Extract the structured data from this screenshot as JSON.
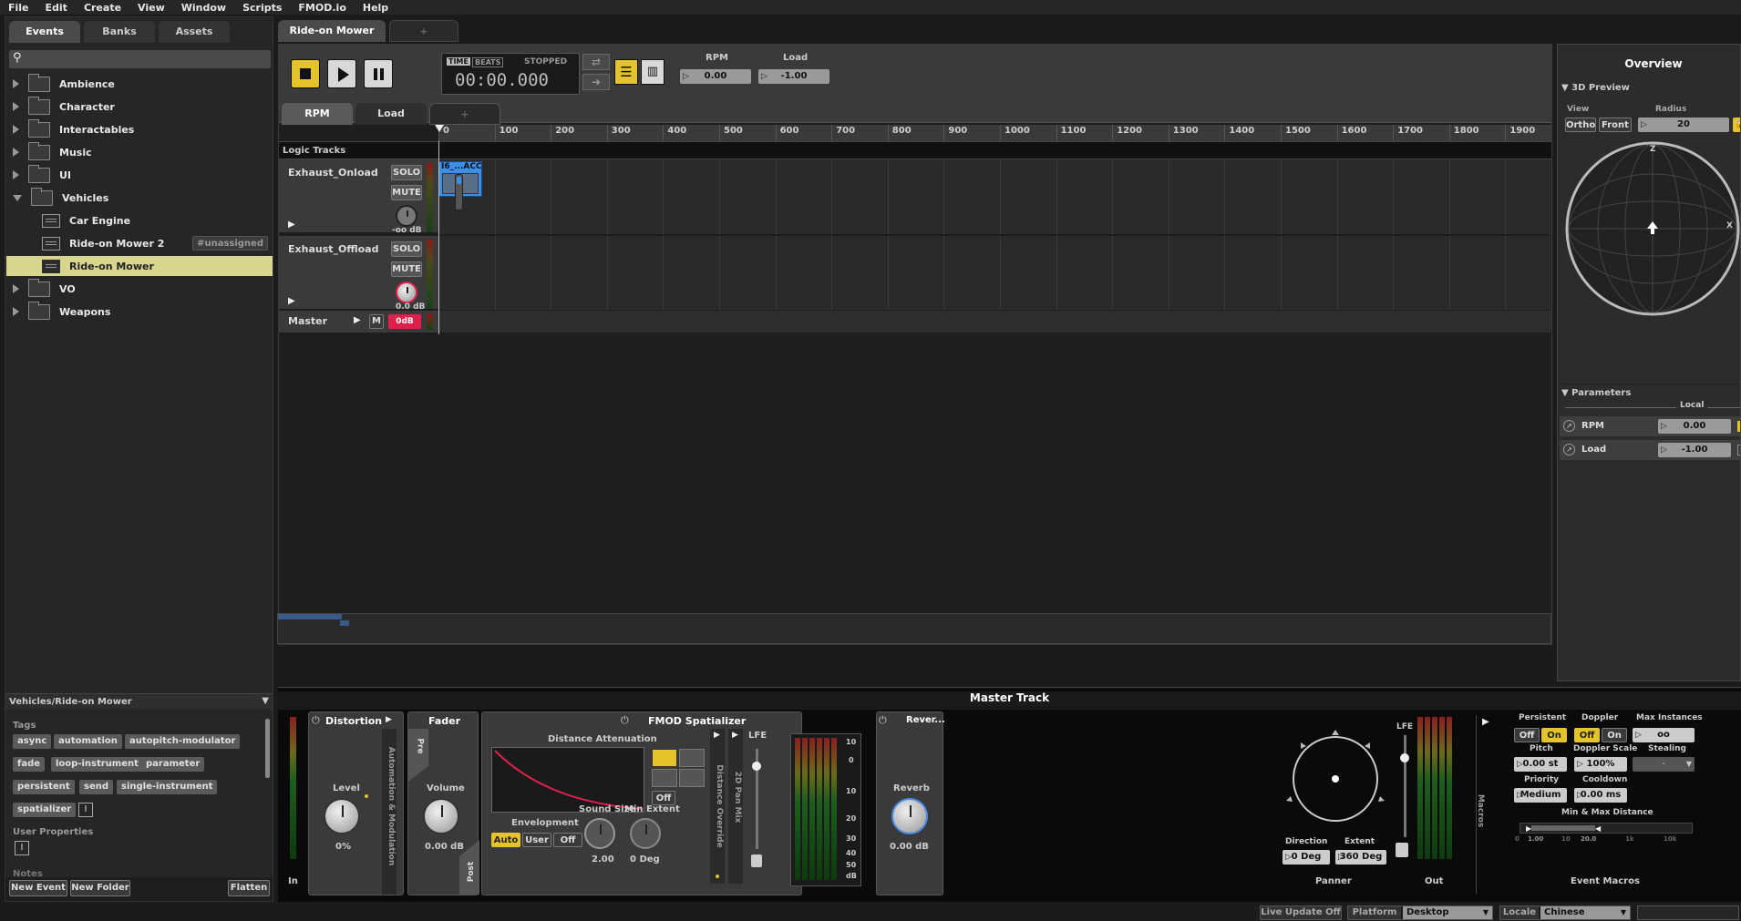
{
  "menu": [
    "File",
    "Edit",
    "Create",
    "View",
    "Window",
    "Scripts",
    "FMOD.io",
    "Help"
  ],
  "browser": {
    "tabs": [
      "Events",
      "Banks",
      "Assets"
    ],
    "search_placeholder": "",
    "items": [
      {
        "label": "Ambience",
        "type": "folder"
      },
      {
        "label": "Character",
        "type": "folder"
      },
      {
        "label": "Interactables",
        "type": "folder"
      },
      {
        "label": "Music",
        "type": "folder"
      },
      {
        "label": "UI",
        "type": "folder"
      },
      {
        "label": "Vehicles",
        "type": "folder-open"
      },
      {
        "label": "Car Engine",
        "type": "event"
      },
      {
        "label": "Ride-on Mower 2",
        "type": "event",
        "badge": "#unassigned"
      },
      {
        "label": "Ride-on Mower",
        "type": "event",
        "selected": true
      },
      {
        "label": "VO",
        "type": "folder"
      },
      {
        "label": "Weapons",
        "type": "folder"
      }
    ],
    "path": "Vehicles/Ride-on Mower",
    "tags_label": "Tags",
    "tags": [
      "async",
      "automation",
      "autopitch-modulator",
      "fade",
      "loop-instrument",
      "parameter",
      "persistent",
      "send",
      "single-instrument",
      "spatializer"
    ],
    "user_properties_label": "User Properties",
    "notes_label": "Notes",
    "new_event": "New Event",
    "new_folder": "New Folder",
    "flatten": "Flatten"
  },
  "editor": {
    "tab": "Ride-on Mower",
    "add_tab": "+",
    "transport": {
      "time_label": "TIME",
      "beats_label": "BEATS",
      "state": "STOPPED",
      "time": "00:00.000"
    },
    "params_header": [
      {
        "name": "RPM",
        "value": "0.00"
      },
      {
        "name": "Load",
        "value": "-1.00"
      }
    ],
    "param_tabs": [
      "RPM",
      "Load",
      "+"
    ],
    "logic_tracks": "Logic Tracks",
    "ruler": [
      "0",
      "100",
      "200",
      "300",
      "400",
      "500",
      "600",
      "700",
      "800",
      "900",
      "1000",
      "1100",
      "1200",
      "1300",
      "1400",
      "1500",
      "1600",
      "1700",
      "1800",
      "1900"
    ],
    "tracks": [
      {
        "name": "Exhaust_Onload",
        "solo": "SOLO",
        "mute": "MUTE",
        "vol": "-oo dB",
        "region": "I6_...ACC"
      },
      {
        "name": "Exhaust_Offload",
        "solo": "SOLO",
        "mute": "MUTE",
        "vol": "0.0 dB"
      }
    ],
    "master": {
      "name": "Master",
      "m": "M",
      "vol": "0dB"
    }
  },
  "overview": {
    "title": "Overview",
    "preview_label": "3D Preview",
    "view_label": "View",
    "radius_label": "Radius",
    "ortho": "Ortho",
    "front": "Front",
    "radius": "20",
    "axis_z": "Z",
    "axis_x": "X",
    "parameters_label": "Parameters",
    "local_label": "Local",
    "params": [
      {
        "name": "RPM",
        "value": "0.00"
      },
      {
        "name": "Load",
        "value": "-1.00"
      }
    ]
  },
  "deck": {
    "title": "Master Track",
    "in_label": "In",
    "distortion": {
      "title": "Distortion",
      "level_label": "Level",
      "level": "0%",
      "automation": "Automation & Modulation"
    },
    "fader": {
      "title": "Fader",
      "pre": "Pre",
      "post": "Post",
      "volume_label": "Volume",
      "volume": "0.00 dB"
    },
    "spatializer": {
      "title": "FMOD Spatializer",
      "atten_label": "Distance Attenuation",
      "off": "Off",
      "envelopment": "Envelopment",
      "env_opts": [
        "Auto",
        "User",
        "Off"
      ],
      "sound_size_label": "Sound Size",
      "sound_size": "2.00",
      "min_extent_label": "Min Extent",
      "min_extent": "0 Deg",
      "override": "Distance Override",
      "panmix": "2D Pan Mix",
      "lfe": "LFE",
      "meter_scale": [
        "10",
        "0",
        "10",
        "20",
        "30",
        "40",
        "50",
        "dB"
      ]
    },
    "reverb": {
      "title": "Rever...",
      "reverb_label": "Reverb",
      "reverb": "0.00 dB"
    },
    "panner": {
      "label": "Panner",
      "direction_label": "Direction",
      "direction": "0 Deg",
      "extent_label": "Extent",
      "extent": "360 Deg",
      "lfe": "LFE"
    },
    "out_label": "Out",
    "macros": {
      "label": "Macros",
      "title": "Event Macros",
      "persistent_label": "Persistent",
      "doppler_label": "Doppler",
      "max_instances_label": "Max Instances",
      "off": "Off",
      "on": "On",
      "max_instances": "oo",
      "pitch_label": "Pitch",
      "pitch": "0.00 st",
      "doppler_scale_label": "Doppler Scale",
      "doppler_scale": "100%",
      "stealing_label": "Stealing",
      "stealing": "-",
      "priority_label": "Priority",
      "priority": "Medium",
      "cooldown_label": "Cooldown",
      "cooldown": "0.00 ms",
      "distance_label": "Min & Max Distance",
      "dist_ticks": [
        "0",
        "1.00",
        "10",
        "20.0",
        "1k",
        "10k"
      ]
    }
  },
  "status": {
    "live_update": "Live Update Off",
    "platform_label": "Platform",
    "platform": "Desktop",
    "locale_label": "Locale",
    "locale": "Chinese"
  },
  "colors": {
    "accent": "#e5c42b",
    "selected_row": "#d8d58f",
    "region": "#3b8fe6",
    "knob_red": "#e0204a"
  }
}
